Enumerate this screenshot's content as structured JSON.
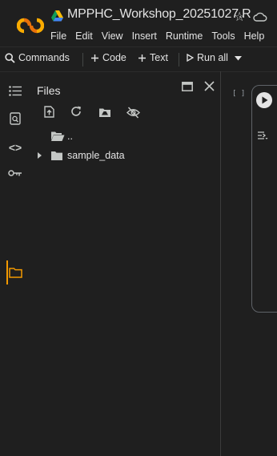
{
  "app": {
    "notebook_title": "MPPHC_Workshop_20251027.R",
    "menu": [
      "File",
      "Edit",
      "View",
      "Insert",
      "Runtime",
      "Tools",
      "Help"
    ]
  },
  "toolbar": {
    "commands_label": "Commands",
    "code_label": "Code",
    "text_label": "Text",
    "run_all_label": "Run all"
  },
  "sidebar": {
    "panel_title": "Files",
    "rail_items": [
      "table-of-contents",
      "find-replace",
      "code-snippets",
      "secrets",
      "files"
    ],
    "active_item": "files"
  },
  "files": {
    "tree": [
      {
        "label": "..",
        "type": "parent-folder"
      },
      {
        "label": "sample_data",
        "type": "folder",
        "expanded": false
      }
    ]
  },
  "cell": {
    "bracket_label": "[ ]"
  },
  "colors": {
    "background": "#1f1f1f",
    "text": "#e3e3e3",
    "icon": "#c4c7c5",
    "accent_active": "#f29900",
    "logo_orange": "#f9ab00",
    "logo_dark": "#e8710a"
  },
  "icons": {
    "logo": "colab-logo",
    "drive": "google-drive-icon",
    "star": "star-icon",
    "cloud": "cloud-sync-icon"
  }
}
